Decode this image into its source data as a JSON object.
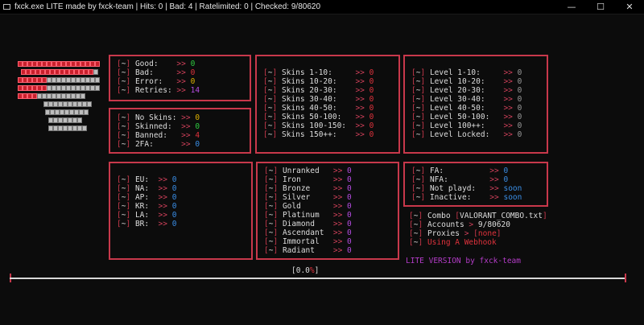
{
  "window": {
    "title": "fxck.exe LITE made by fxck-team | Hits: 0 | Bad: 4 | Ratelimited: 0 | Checked: 9/80620",
    "minimize": "—",
    "maximize": "☐",
    "close": "✕"
  },
  "glyphs": {
    "tilde": "~",
    "arrow": ">>",
    "lb": "[",
    "rb": "]",
    "gt": ">"
  },
  "colors": {
    "border": "#c8384b",
    "background": "#0c0c0c"
  },
  "logo": {
    "rows": [
      "rrrrrrrrrrrrrrrrr",
      "rrrrrrrrrrrrrrrw",
      "rrrrrrwwwwwwwwwww",
      "rrrrrrwwwwwwwwwww",
      "rrrrwwwwwwwwww",
      "wwwwwwwwww",
      "wwwwwwwww",
      "wwwwwww",
      "wwwwwwww"
    ]
  },
  "stats": {
    "items": [
      {
        "label": "Good:    ",
        "value": "0",
        "color": "green"
      },
      {
        "label": "Bad:     ",
        "value": "0",
        "color": "red"
      },
      {
        "label": "Error:   ",
        "value": "0",
        "color": "yellow"
      },
      {
        "label": "Retries: ",
        "value": "14",
        "color": "purple"
      }
    ]
  },
  "skins_status": {
    "items": [
      {
        "label": "No Skins: ",
        "value": "0",
        "color": "yellow"
      },
      {
        "label": "Skinned:  ",
        "value": "0",
        "color": "green"
      },
      {
        "label": "Banned:   ",
        "value": "4",
        "color": "red"
      },
      {
        "label": "2FA:      ",
        "value": "0",
        "color": "blue"
      }
    ]
  },
  "skins": {
    "items": [
      {
        "label": "Skins 1-10:     ",
        "value": "0"
      },
      {
        "label": "Skins 10-20:    ",
        "value": "0"
      },
      {
        "label": "Skins 20-30:    ",
        "value": "0"
      },
      {
        "label": "Skins 30-40:    ",
        "value": "0"
      },
      {
        "label": "Skins 40-50:    ",
        "value": "0"
      },
      {
        "label": "Skins 50-100:   ",
        "value": "0"
      },
      {
        "label": "Skins 100-150:  ",
        "value": "0"
      },
      {
        "label": "Skins 150++:    ",
        "value": "0"
      }
    ]
  },
  "levels": {
    "items": [
      {
        "label": "Level 1-10:     ",
        "value": "0"
      },
      {
        "label": "Level 10-20:    ",
        "value": "0"
      },
      {
        "label": "Level 20-30:    ",
        "value": "0"
      },
      {
        "label": "Level 30-40:    ",
        "value": "0"
      },
      {
        "label": "Level 40-50:    ",
        "value": "0"
      },
      {
        "label": "Level 50-100:   ",
        "value": "0"
      },
      {
        "label": "Level 100++:    ",
        "value": "0"
      },
      {
        "label": "Level Locked:   ",
        "value": "0"
      }
    ]
  },
  "regions": {
    "items": [
      {
        "label": "EU:  ",
        "value": "0"
      },
      {
        "label": "NA:  ",
        "value": "0"
      },
      {
        "label": "AP:  ",
        "value": "0"
      },
      {
        "label": "KR:  ",
        "value": "0"
      },
      {
        "label": "LA:  ",
        "value": "0"
      },
      {
        "label": "BR:  ",
        "value": "0"
      }
    ]
  },
  "ranks": {
    "items": [
      {
        "label": "Unranked   ",
        "value": "0"
      },
      {
        "label": "Iron       ",
        "value": "0"
      },
      {
        "label": "Bronze     ",
        "value": "0"
      },
      {
        "label": "Silver     ",
        "value": "0"
      },
      {
        "label": "Gold       ",
        "value": "0"
      },
      {
        "label": "Platinum   ",
        "value": "0"
      },
      {
        "label": "Diamond    ",
        "value": "0"
      },
      {
        "label": "Ascendant  ",
        "value": "0"
      },
      {
        "label": "Immortal   ",
        "value": "0"
      },
      {
        "label": "Radiant    ",
        "value": "0"
      }
    ]
  },
  "misc": {
    "items": [
      {
        "label": "FA:          ",
        "value": "0"
      },
      {
        "label": "NFA:         ",
        "value": "0"
      },
      {
        "label": "Not playd:   ",
        "value": "soon"
      },
      {
        "label": "Inactive:    ",
        "value": "soon"
      }
    ]
  },
  "info": {
    "combo_label": "Combo ",
    "combo_file": "VALORANT_COMBO.txt",
    "accounts_label": "Accounts ",
    "accounts_value": " 9/80620",
    "proxies_label": "Proxies ",
    "proxies_value": "none",
    "webhook": "Using A Webhook",
    "version": "LITE VERSION by fxck-team"
  },
  "progress": {
    "text_left": "[0.0",
    "text_pct": "%",
    "text_right": "]",
    "fraction": 0.0
  }
}
